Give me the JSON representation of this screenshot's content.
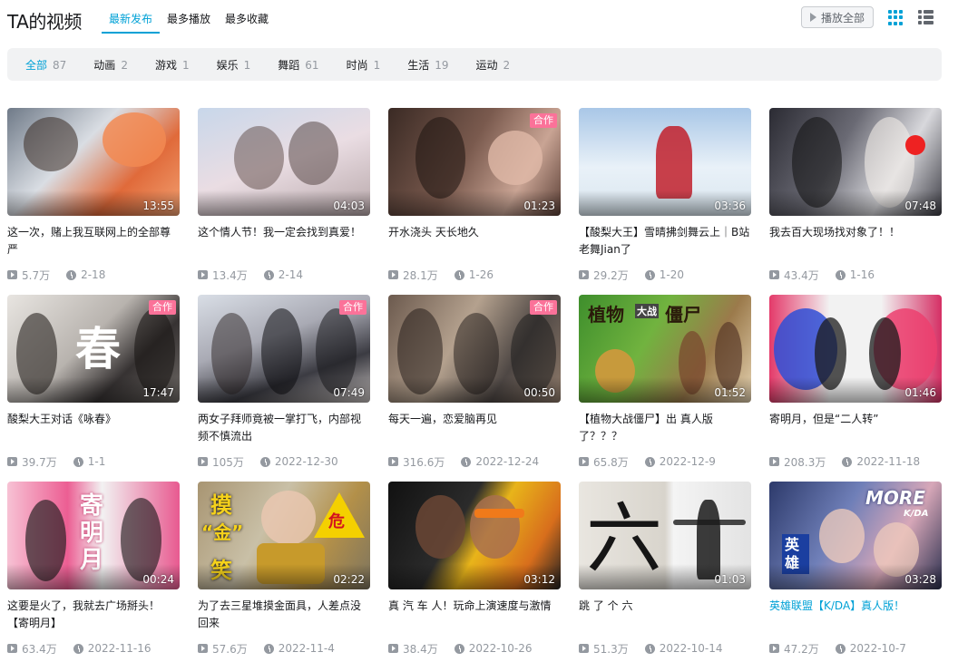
{
  "header": {
    "title": "TA的视频",
    "sort_tabs": [
      "最新发布",
      "最多播放",
      "最多收藏"
    ],
    "play_all_label": "播放全部"
  },
  "filters": [
    {
      "label": "全部",
      "count": "87"
    },
    {
      "label": "动画",
      "count": "2"
    },
    {
      "label": "游戏",
      "count": "1"
    },
    {
      "label": "娱乐",
      "count": "1"
    },
    {
      "label": "舞蹈",
      "count": "61"
    },
    {
      "label": "时尚",
      "count": "1"
    },
    {
      "label": "生活",
      "count": "19"
    },
    {
      "label": "运动",
      "count": "2"
    }
  ],
  "collab_badge": "合作",
  "videos": [
    {
      "title": "这一次，赌上我互联网上的全部尊严",
      "duration": "13:55",
      "plays": "5.7万",
      "date": "2-18"
    },
    {
      "title": "这个情人节！我一定会找到真爱！",
      "duration": "04:03",
      "plays": "13.4万",
      "date": "2-14"
    },
    {
      "title": "开水浇头 天长地久",
      "duration": "01:23",
      "plays": "28.1万",
      "date": "1-26"
    },
    {
      "title": "【酸梨大王】雪晴拂剑舞云上｜B站老舞Jian了",
      "duration": "03:36",
      "plays": "29.2万",
      "date": "1-20"
    },
    {
      "title": "我去百大现场找对象了！！",
      "duration": "07:48",
      "plays": "43.4万",
      "date": "1-16"
    },
    {
      "title": "酸梨大王对话《咏春》",
      "duration": "17:47",
      "plays": "39.7万",
      "date": "1-1"
    },
    {
      "title": "两女子拜师竟被一掌打飞，内部视频不慎流出",
      "duration": "07:49",
      "plays": "105万",
      "date": "2022-12-30"
    },
    {
      "title": "每天一遍，恋爱脑再见",
      "duration": "00:50",
      "plays": "316.6万",
      "date": "2022-12-24"
    },
    {
      "title": "【植物大战僵尸】出 真人版了？？？",
      "duration": "01:52",
      "plays": "65.8万",
      "date": "2022-12-9"
    },
    {
      "title": "寄明月，但是“二人转”",
      "duration": "01:46",
      "plays": "208.3万",
      "date": "2022-11-18"
    },
    {
      "title": "这要是火了，我就去广场掰头！【寄明月】",
      "duration": "00:24",
      "plays": "63.4万",
      "date": "2022-11-16"
    },
    {
      "title": "为了去三星堆摸金面具，人差点没回来",
      "duration": "02:22",
      "plays": "57.6万",
      "date": "2022-11-4"
    },
    {
      "title": "真 汽 车 人！玩命上演速度与激情",
      "duration": "03:12",
      "plays": "38.4万",
      "date": "2022-10-26"
    },
    {
      "title": "跳 了 个 六",
      "duration": "01:03",
      "plays": "51.3万",
      "date": "2022-10-14"
    },
    {
      "title": "英雄联盟【K/DA】真人版！",
      "duration": "03:28",
      "plays": "47.2万",
      "date": "2022-10-7"
    }
  ],
  "thumb_text": {
    "v6": "春",
    "v9_a": "植物",
    "v9_b": "大战",
    "v9_c": "僵尸",
    "v11": "寄明月",
    "v12_a": "摸",
    "v12_b": "“金”",
    "v12_c": "笑",
    "v12_d": "危",
    "v14": "六",
    "v15_a": "MORE",
    "v15_b": "K/DA",
    "v15_c": "英雄"
  },
  "colors": {
    "accent": "#00a1d6",
    "collab_badge": "#fb7299",
    "meta_gray": "#9499a0"
  }
}
